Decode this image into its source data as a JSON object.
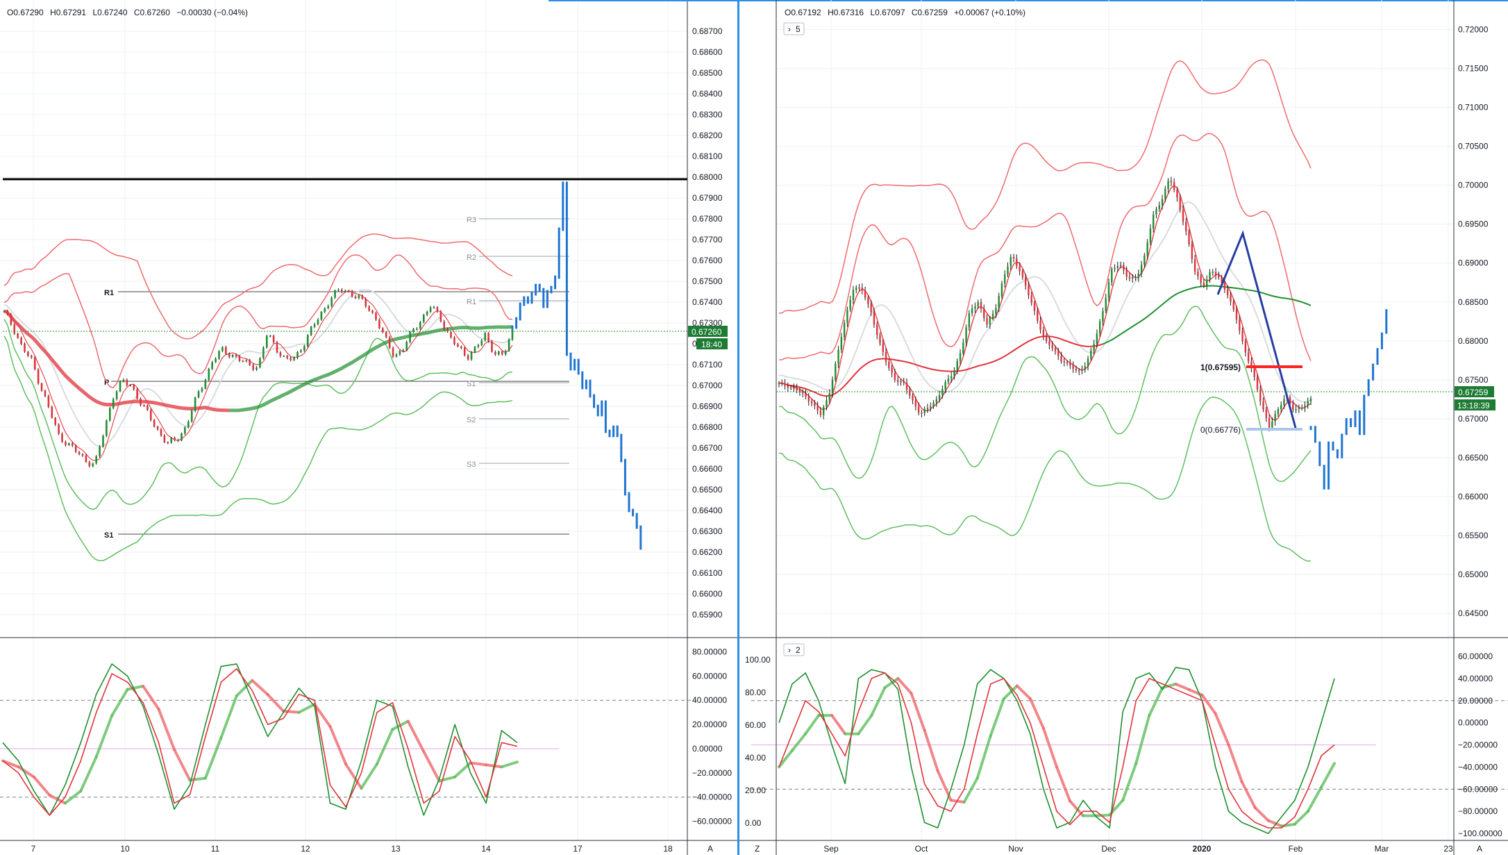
{
  "colors": {
    "up": "#1e8f2e",
    "down": "#e0333a",
    "proj": "#1f74d1",
    "bb_red": "#f0696e",
    "bb_green": "#5ebf60",
    "ma_grey": "#d9dbde",
    "grid": "#eef0f3",
    "panel_border": "#2a2e39",
    "price_tag": "#1e7b34",
    "fib_red": "#ff2222",
    "fib_blue": "#a9c6ee",
    "zigzag": "#253da3",
    "pink": "#e9a6e2",
    "dash": "#7d7f82"
  },
  "left": {
    "ohlc": {
      "o": "O0.67290",
      "h": "H0.67291",
      "l": "L0.67240",
      "c": "C0.67260",
      "chg": "−0.00030 (−0.04%)"
    },
    "price_tag": "0.67260",
    "time_tag": "18:40",
    "y_ticks": [
      "0.68700",
      "0.68600",
      "0.68500",
      "0.68400",
      "0.68300",
      "0.68200",
      "0.68100",
      "0.68000",
      "0.67900",
      "0.67800",
      "0.67700",
      "0.67600",
      "0.67500",
      "0.67400",
      "0.67300",
      "0.67200",
      "0.67100",
      "0.67000",
      "0.66900",
      "0.66800",
      "0.66700",
      "0.66600",
      "0.66500",
      "0.66400",
      "0.66300",
      "0.66200",
      "0.66100",
      "0.66000",
      "0.65900"
    ],
    "x_ticks": [
      "7",
      "10",
      "11",
      "12",
      "13",
      "14",
      "17",
      "18"
    ],
    "osc_ticks": [
      "80.00000",
      "60.00000",
      "40.00000",
      "20.00000",
      "0.00000",
      "−20.00000",
      "−40.00000",
      "−60.00000"
    ],
    "pivots": {
      "r1": "R1",
      "p": "P",
      "s1": "S1",
      "r3": "R3",
      "r2": "R2",
      "r1b": "R1",
      "s1b": "S1",
      "s2": "S2",
      "s3": "S3"
    },
    "corner_label": "A"
  },
  "right": {
    "ohlc": {
      "o": "O0.67192",
      "h": "H0.67316",
      "l": "L0.67097",
      "c": "C0.67259",
      "chg": "+0.00067 (+0.10%)"
    },
    "collapse_label": "5",
    "osc_collapse_label": "2",
    "price_tag": "0.67259",
    "time_tag": "13:18:39",
    "y_ticks": [
      "0.72000",
      "0.71500",
      "0.71000",
      "0.70500",
      "0.70000",
      "0.69500",
      "0.69000",
      "0.68500",
      "0.68000",
      "0.67500",
      "0.67000",
      "0.66500",
      "0.66000",
      "0.65500",
      "0.65000",
      "0.64500"
    ],
    "x_ticks": [
      "Sep",
      "Oct",
      "Nov",
      "Dec",
      "2020",
      "Feb",
      "Mar",
      "23"
    ],
    "osc_left_ticks": [
      "100.00",
      "80.00",
      "60.00",
      "40.00",
      "20.00",
      "0.00"
    ],
    "osc_right_ticks": [
      "60.00000",
      "40.00000",
      "20.00000",
      "0.00000",
      "−20.00000",
      "−40.00000",
      "−60.00000",
      "−80.00000",
      "−100.00000"
    ],
    "fib_top": "1(0.67595)",
    "fib_bottom": "0(0.66776)",
    "corner_left": "Z",
    "corner_right": "A"
  },
  "chart_data": [
    {
      "type": "candlestick",
      "title": "",
      "timeframe_ticks": [
        "7",
        "10",
        "11",
        "12",
        "13",
        "14",
        "17",
        "18"
      ],
      "ylim": [
        0.6585,
        0.6875
      ],
      "horizontal_levels": {
        "resistance_black": 0.6797,
        "R1": 0.6745,
        "P": 0.6704,
        "S1": 0.6633,
        "R3": 0.6778,
        "R2": 0.6762,
        "S2": 0.6688,
        "S3": 0.6663
      },
      "close_anchors": [
        0.6735,
        0.6728,
        0.6718,
        0.6712,
        0.67,
        0.6688,
        0.6676,
        0.6672,
        0.6668,
        0.6664,
        0.6662,
        0.6678,
        0.6695,
        0.6702,
        0.67,
        0.6692,
        0.6685,
        0.6678,
        0.6672,
        0.6674,
        0.668,
        0.6692,
        0.6702,
        0.6712,
        0.6717,
        0.6715,
        0.6712,
        0.671,
        0.6709,
        0.6725,
        0.6718,
        0.6712,
        0.6713,
        0.672,
        0.6728,
        0.6735,
        0.6742,
        0.6746,
        0.6745,
        0.6742,
        0.6738,
        0.6732,
        0.6722,
        0.6714,
        0.6718,
        0.6726,
        0.6732,
        0.6738,
        0.6733,
        0.6724,
        0.6718,
        0.6714,
        0.6718,
        0.6724,
        0.6716,
        0.6714,
        0.6726
      ],
      "projection": [
        0.6728,
        0.6732,
        0.6739,
        0.6742,
        0.674,
        0.6744,
        0.6748,
        0.6746,
        0.6738,
        0.6745,
        0.6747,
        0.6752,
        0.6775,
        0.6797,
        0.6715,
        0.6708,
        0.6712,
        0.6706,
        0.6699,
        0.6702,
        0.6695,
        0.669,
        0.6686,
        0.6692,
        0.6678,
        0.6676,
        0.668,
        0.6676,
        0.6664,
        0.6648,
        0.664,
        0.6638,
        0.6632,
        0.6622
      ],
      "oscillator": {
        "ylim": [
          -70,
          82
        ],
        "levels": [
          40,
          -40
        ],
        "k": [
          5,
          -10,
          -35,
          -55,
          -30,
          5,
          45,
          70,
          60,
          35,
          -5,
          -50,
          -30,
          20,
          68,
          70,
          40,
          10,
          30,
          50,
          35,
          -45,
          -50,
          -10,
          40,
          35,
          -15,
          -55,
          -25,
          20,
          -20,
          -45,
          15,
          5
        ],
        "d": [
          -10,
          -20,
          -40,
          -55,
          -40,
          -10,
          30,
          62,
          55,
          38,
          5,
          -45,
          -38,
          10,
          55,
          66,
          48,
          20,
          25,
          45,
          40,
          -30,
          -48,
          -20,
          30,
          38,
          0,
          -45,
          -35,
          10,
          -10,
          -40,
          5,
          2
        ]
      }
    },
    {
      "type": "candlestick",
      "title": "",
      "timeframe_ticks": [
        "Sep",
        "Oct",
        "Nov",
        "Dec",
        "2020",
        "Feb",
        "Mar",
        "23"
      ],
      "ylim": [
        0.6435,
        0.722
      ],
      "fib_levels": {
        "1": 0.67595,
        "0": 0.66776
      },
      "close_anchors": [
        0.6745,
        0.6742,
        0.6738,
        0.673,
        0.672,
        0.6705,
        0.673,
        0.678,
        0.683,
        0.687,
        0.6865,
        0.684,
        0.68,
        0.677,
        0.675,
        0.6745,
        0.6725,
        0.6705,
        0.6715,
        0.6725,
        0.6745,
        0.676,
        0.679,
        0.684,
        0.685,
        0.682,
        0.684,
        0.688,
        0.691,
        0.689,
        0.686,
        0.683,
        0.68,
        0.679,
        0.6775,
        0.6768,
        0.676,
        0.677,
        0.68,
        0.684,
        0.689,
        0.69,
        0.688,
        0.688,
        0.691,
        0.696,
        0.698,
        0.701,
        0.698,
        0.694,
        0.689,
        0.687,
        0.689,
        0.688,
        0.686,
        0.683,
        0.679,
        0.676,
        0.672,
        0.669,
        0.671,
        0.673,
        0.671,
        0.6715,
        0.6726
      ],
      "projection": [
        0.669,
        0.667,
        0.664,
        0.661,
        0.667,
        0.666,
        0.665,
        0.668,
        0.67,
        0.669,
        0.671,
        0.668,
        0.673,
        0.675,
        0.677,
        0.679,
        0.681,
        0.684
      ],
      "oscillator": {
        "ylim": [
          -100,
          60
        ],
        "levels": [
          20,
          -60
        ],
        "k": [
          0,
          35,
          45,
          20,
          -20,
          -55,
          40,
          48,
          45,
          30,
          -40,
          -90,
          -95,
          -60,
          -20,
          35,
          48,
          40,
          20,
          -10,
          -60,
          -95,
          -90,
          -70,
          -85,
          -95,
          10,
          40,
          45,
          30,
          50,
          48,
          20,
          -40,
          -80,
          -90,
          -95,
          -100,
          -85,
          -70,
          -40,
          0,
          40
        ],
        "d": [
          -40,
          -10,
          20,
          10,
          -10,
          -30,
          10,
          40,
          45,
          35,
          0,
          -55,
          -75,
          -80,
          -60,
          -10,
          35,
          40,
          25,
          0,
          -40,
          -80,
          -92,
          -80,
          -80,
          -90,
          -40,
          20,
          40,
          35,
          30,
          25,
          20,
          -20,
          -60,
          -80,
          -90,
          -95,
          -95,
          -85,
          -60,
          -30,
          -20
        ]
      }
    }
  ]
}
